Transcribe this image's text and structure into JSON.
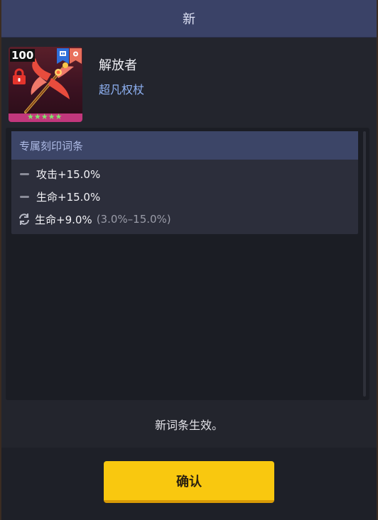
{
  "header": {
    "title": "新"
  },
  "item": {
    "level": "100",
    "name": "解放者",
    "type": "超凡权杖",
    "stars": "★★★★★"
  },
  "engrave": {
    "title": "专属刻印词条",
    "stats": [
      {
        "text": "攻击+15.0%",
        "icon": "dash-icon"
      },
      {
        "text": "生命+15.0%",
        "icon": "dash-icon"
      },
      {
        "text": "生命+9.0%",
        "range": "(3.0%–15.0%)",
        "icon": "refresh-icon"
      }
    ]
  },
  "notice": "新词条生效。",
  "confirm_label": "确认",
  "colors": {
    "header_bg": "#3a4267",
    "confirm_bg": "#f9c80f",
    "accent_blue": "#8fb2f4",
    "stars_green": "#7ee86a"
  }
}
